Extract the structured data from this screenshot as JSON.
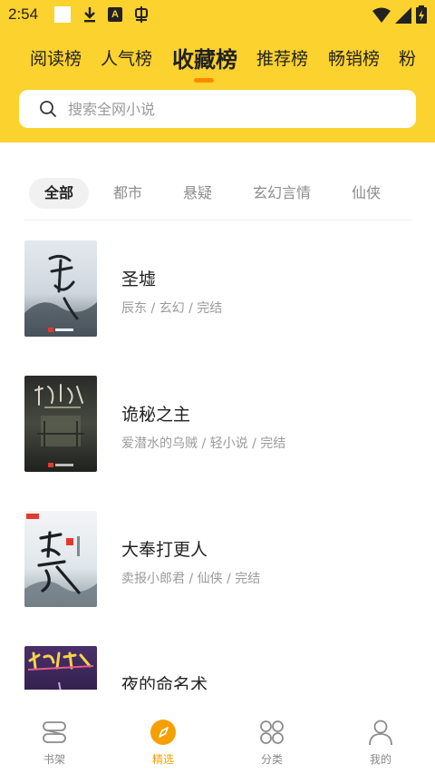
{
  "status_bar": {
    "time": "2:54"
  },
  "tabs": [
    {
      "label": "阅读榜",
      "active": false
    },
    {
      "label": "人气榜",
      "active": false
    },
    {
      "label": "收藏榜",
      "active": true
    },
    {
      "label": "推荐榜",
      "active": false
    },
    {
      "label": "畅销榜",
      "active": false
    },
    {
      "label": "粉",
      "active": false
    }
  ],
  "search": {
    "placeholder": "搜索全网小说"
  },
  "categories": [
    {
      "label": "全部",
      "active": true
    },
    {
      "label": "都市",
      "active": false
    },
    {
      "label": "悬疑",
      "active": false
    },
    {
      "label": "玄幻言情",
      "active": false
    },
    {
      "label": "仙侠",
      "active": false
    }
  ],
  "books": [
    {
      "title": "圣墟",
      "meta": "辰东 / 玄幻 / 完结"
    },
    {
      "title": "诡秘之主",
      "meta": "爱潜水的乌贼 / 轻小说 / 完结"
    },
    {
      "title": "大奉打更人",
      "meta": "卖报小郎君 / 仙侠 / 完结"
    },
    {
      "title": "夜的命名术",
      "meta": ""
    }
  ],
  "bottom_nav": [
    {
      "label": "书架",
      "icon": "bookshelf-icon",
      "active": false
    },
    {
      "label": "精选",
      "icon": "compass-icon",
      "active": true
    },
    {
      "label": "分类",
      "icon": "category-grid-icon",
      "active": false
    },
    {
      "label": "我的",
      "icon": "user-icon",
      "active": false
    }
  ],
  "colors": {
    "header_bg": "#fcd22e",
    "accent": "#ff8a00",
    "nav_active": "#f5a000"
  }
}
